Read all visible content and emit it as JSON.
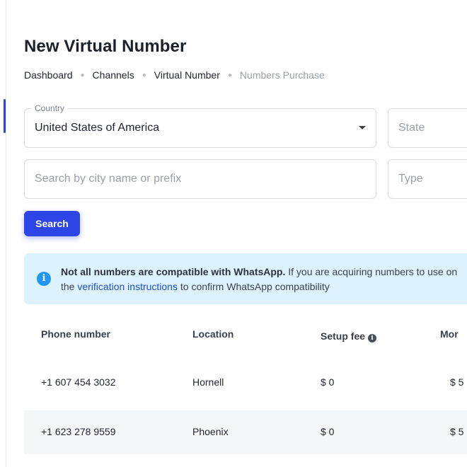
{
  "page": {
    "title": "New Virtual Number"
  },
  "breadcrumb": {
    "items": [
      "Dashboard",
      "Channels",
      "Virtual Number",
      "Numbers Purchase"
    ]
  },
  "filters": {
    "country_label": "Country",
    "country_value": "United States of America",
    "state_placeholder": "State",
    "search_placeholder": "Search by city name or prefix",
    "type_placeholder": "Type",
    "search_button": "Search"
  },
  "alert": {
    "bold": "Not all numbers are compatible with WhatsApp.",
    "text_1": " If you are acquiring numbers to use on",
    "text_2": "the ",
    "link": "verification instructions",
    "text_3": " to confirm WhatsApp compatibility"
  },
  "table": {
    "headers": [
      "Phone number",
      "Location",
      "Setup fee",
      "Mor"
    ],
    "rows": [
      {
        "phone": "+1 607 454 3032",
        "location": "Hornell",
        "setup_fee": "$ 0",
        "monthly": "$ 5"
      },
      {
        "phone": "+1 623 278 9559",
        "location": "Phoenix",
        "setup_fee": "$ 0",
        "monthly": "$ 5"
      }
    ]
  },
  "colors": {
    "primary": "#2d44e6",
    "alert_bg": "#ddf2fc",
    "alert_icon": "#2196f3",
    "link": "#1f4fd8"
  }
}
